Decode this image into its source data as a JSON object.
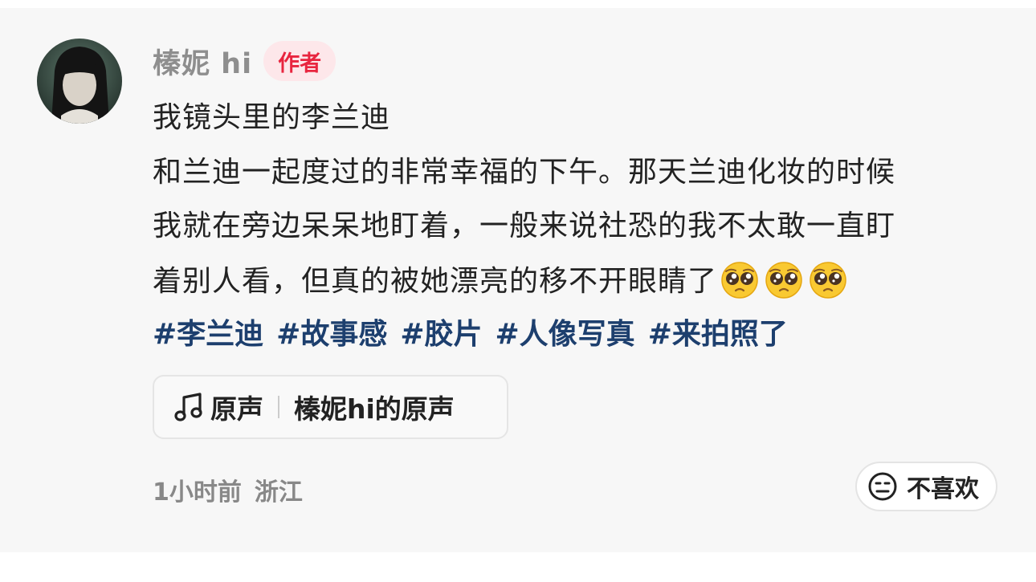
{
  "author": {
    "name": "榛妮 hi",
    "badge": "作者"
  },
  "post": {
    "lines": [
      "我镜头里的李兰迪",
      "和兰迪一起度过的非常幸福的下午。那天兰迪化妆的时候",
      "我就在旁边呆呆地盯着，一般来说社恐的我不太敢一直盯",
      "着别人看，但真的被她漂亮的移不开眼睛了"
    ],
    "emoji_icon": "pleading-face-emoji",
    "emoji_count": 3,
    "tags": [
      "#李兰迪",
      "#故事感",
      "#胶片",
      "#人像写真",
      "#来拍照了"
    ]
  },
  "music": {
    "icon": "music-note-icon",
    "label": "原声",
    "title": "榛妮hi的原声"
  },
  "meta": {
    "time": "1小时前",
    "location": "浙江"
  },
  "dislike": {
    "icon": "meh-face-icon",
    "label": "不喜欢"
  }
}
